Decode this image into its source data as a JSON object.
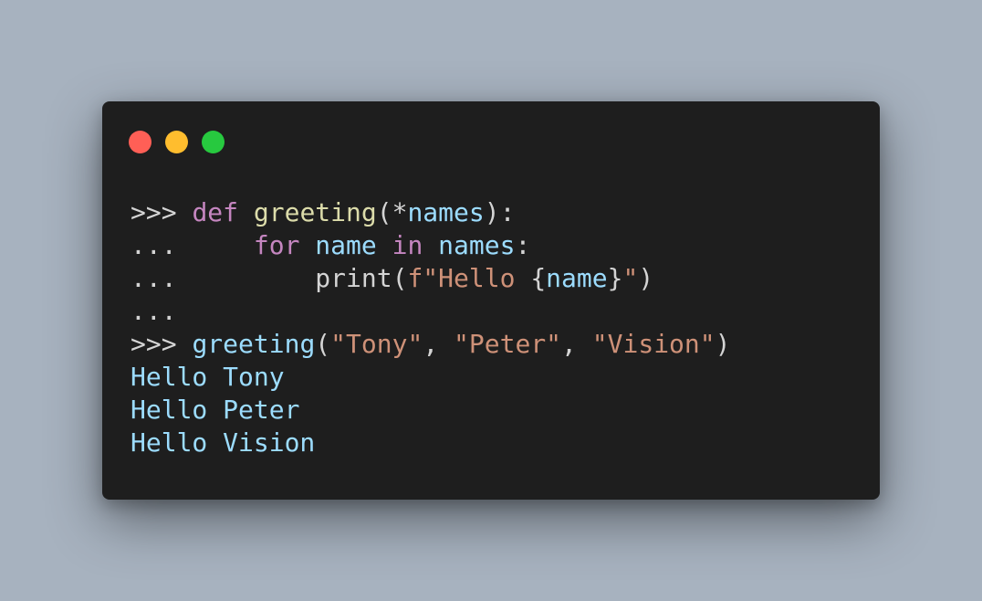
{
  "window": {
    "controls": [
      {
        "name": "close",
        "color": "#ff5f56"
      },
      {
        "name": "minimize",
        "color": "#ffbd2e"
      },
      {
        "name": "maximize",
        "color": "#27c93f"
      }
    ]
  },
  "colors": {
    "prompt": "#d4d4d4",
    "keyword": "#c586c0",
    "function": "#dcdcaa",
    "variable": "#9cdcfe",
    "string": "#ce9178",
    "plain": "#d4d4d4",
    "output": "#9cdcfe"
  },
  "code": {
    "lines": [
      [
        {
          "t": ">>> ",
          "k": "prompt"
        },
        {
          "t": "def",
          "k": "keyword"
        },
        {
          "t": " ",
          "k": "plain"
        },
        {
          "t": "greeting",
          "k": "function"
        },
        {
          "t": "(",
          "k": "plain"
        },
        {
          "t": "*",
          "k": "plain"
        },
        {
          "t": "names",
          "k": "variable"
        },
        {
          "t": "):",
          "k": "plain"
        }
      ],
      [
        {
          "t": "...     ",
          "k": "prompt"
        },
        {
          "t": "for",
          "k": "keyword"
        },
        {
          "t": " ",
          "k": "plain"
        },
        {
          "t": "name",
          "k": "variable"
        },
        {
          "t": " ",
          "k": "plain"
        },
        {
          "t": "in",
          "k": "keyword"
        },
        {
          "t": " ",
          "k": "plain"
        },
        {
          "t": "names",
          "k": "variable"
        },
        {
          "t": ":",
          "k": "plain"
        }
      ],
      [
        {
          "t": "...         ",
          "k": "prompt"
        },
        {
          "t": "print",
          "k": "plain"
        },
        {
          "t": "(",
          "k": "plain"
        },
        {
          "t": "f\"Hello ",
          "k": "string"
        },
        {
          "t": "{",
          "k": "plain"
        },
        {
          "t": "name",
          "k": "variable"
        },
        {
          "t": "}",
          "k": "plain"
        },
        {
          "t": "\"",
          "k": "string"
        },
        {
          "t": ")",
          "k": "plain"
        }
      ],
      [
        {
          "t": "...",
          "k": "prompt"
        }
      ],
      [
        {
          "t": ">>> ",
          "k": "prompt"
        },
        {
          "t": "greeting",
          "k": "variable"
        },
        {
          "t": "(",
          "k": "plain"
        },
        {
          "t": "\"Tony\"",
          "k": "string"
        },
        {
          "t": ", ",
          "k": "plain"
        },
        {
          "t": "\"Peter\"",
          "k": "string"
        },
        {
          "t": ", ",
          "k": "plain"
        },
        {
          "t": "\"Vision\"",
          "k": "string"
        },
        {
          "t": ")",
          "k": "plain"
        }
      ],
      [
        {
          "t": "Hello Tony",
          "k": "output"
        }
      ],
      [
        {
          "t": "Hello Peter",
          "k": "output"
        }
      ],
      [
        {
          "t": "Hello Vision",
          "k": "output"
        }
      ]
    ]
  }
}
